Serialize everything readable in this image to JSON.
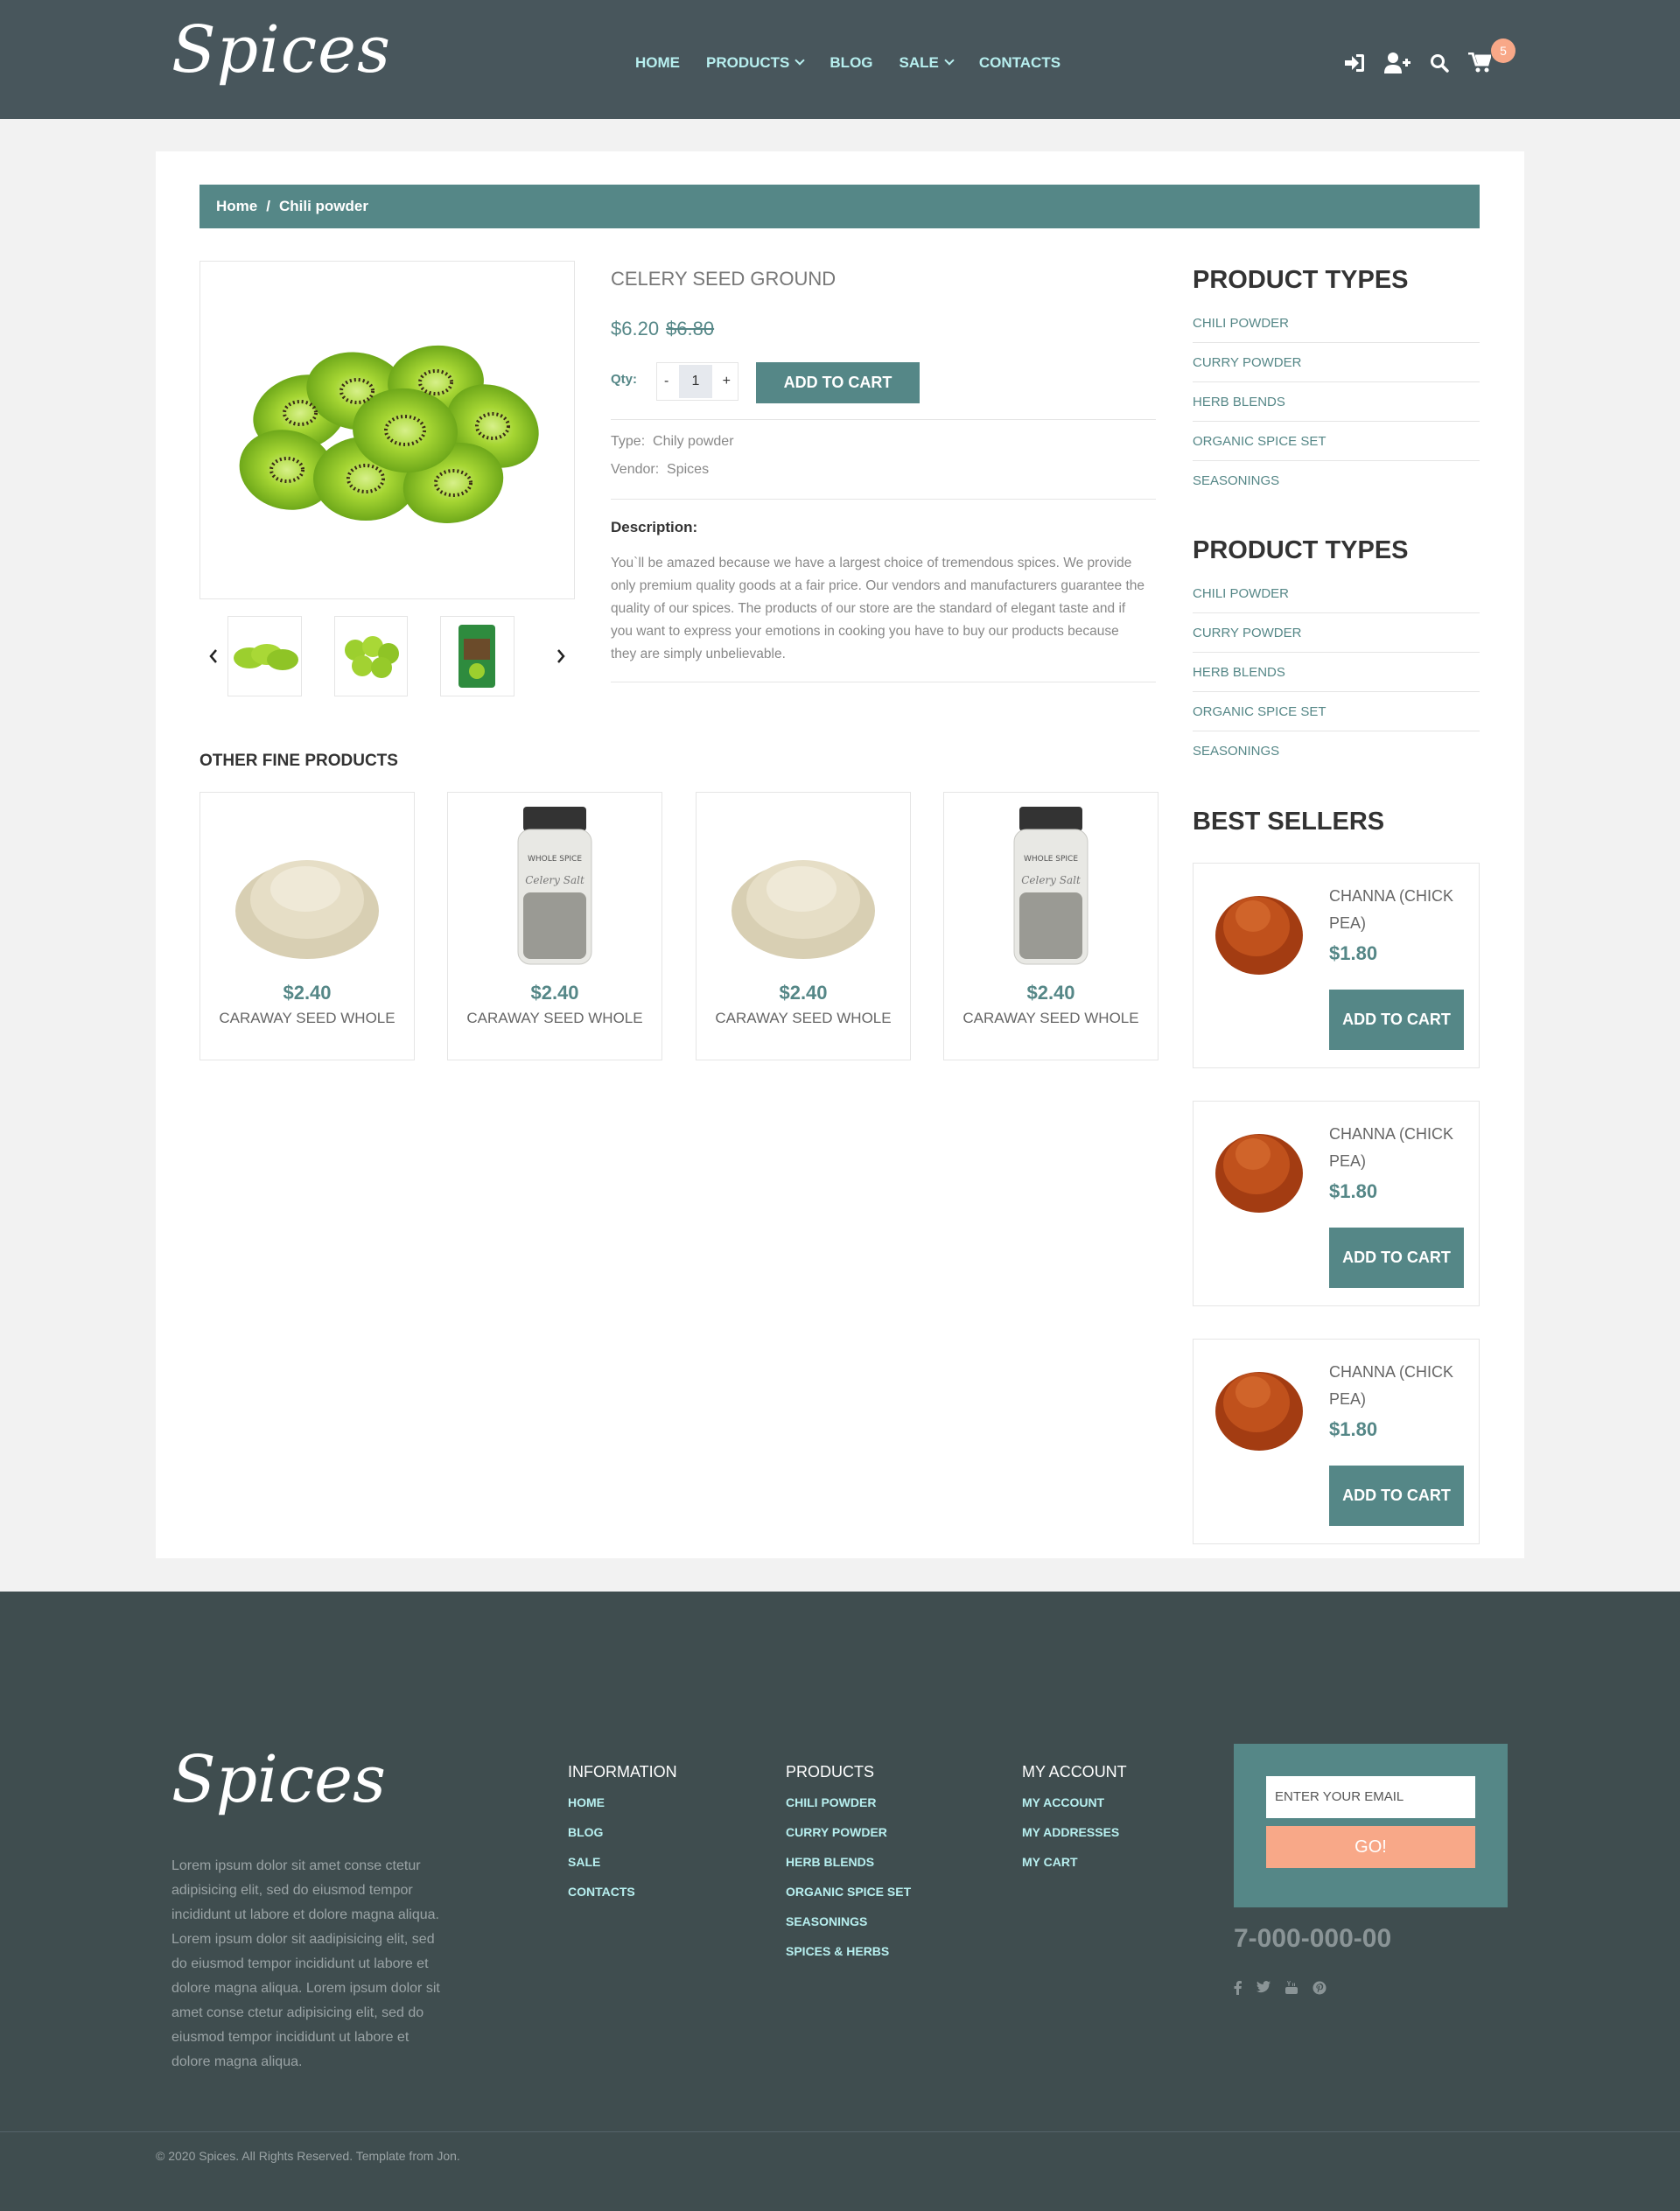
{
  "header": {
    "logo": "Spices",
    "nav": [
      {
        "label": "HOME"
      },
      {
        "label": "PRODUCTS"
      },
      {
        "label": "BLOG"
      },
      {
        "label": "SALE"
      },
      {
        "label": "CONTACTS"
      }
    ],
    "cart_count": "5"
  },
  "breadcrumb": {
    "home": "Home",
    "sep": "/",
    "current": "Chili powder"
  },
  "product": {
    "title": "CELERY SEED GROUND",
    "price": "$6.20",
    "old_price": "$6.80",
    "qty_label": "Qty:",
    "qty_minus": "-",
    "qty_value": "1",
    "qty_plus": "+",
    "add_to_cart": "ADD TO CART",
    "type_label": "Type:",
    "type_value": "Chily powder",
    "vendor_label": "Vendor:",
    "vendor_value": "Spices",
    "description_heading": "Description:",
    "description": "You`ll be amazed because we have a largest choice of tremendous spices. We provide only premium quality goods at a fair price. Our vendors and manufacturers guarantee the quality of our spices. The products of our store are the standard of elegant taste and if you want to express your emotions in cooking you have to buy our products because they are simply unbelievable."
  },
  "other_products": {
    "heading": "OTHER FINE PRODUCTS",
    "items": [
      {
        "price": "$2.40",
        "name": "CARAWAY SEED WHOLE"
      },
      {
        "price": "$2.40",
        "name": "CARAWAY SEED WHOLE"
      },
      {
        "price": "$2.40",
        "name": "CARAWAY SEED WHOLE"
      },
      {
        "price": "$2.40",
        "name": "CARAWAY SEED WHOLE"
      }
    ],
    "jar_label": "WHOLE SPICE",
    "jar_script": "Celery Salt"
  },
  "sidebar": {
    "types_heading_1": "PRODUCT TYPES",
    "types_1": [
      "CHILI POWDER",
      "CURRY POWDER",
      "HERB BLENDS",
      "ORGANIC SPICE SET",
      "SEASONINGS"
    ],
    "types_heading_2": "PRODUCT TYPES",
    "types_2": [
      "CHILI POWDER",
      "CURRY POWDER",
      "HERB BLENDS",
      "ORGANIC SPICE SET",
      "SEASONINGS"
    ],
    "best_heading": "BEST SELLERS",
    "best": [
      {
        "name": "CHANNA (CHICK PEA)",
        "price": "$1.80",
        "button": "ADD TO CART"
      },
      {
        "name": "CHANNA (CHICK PEA)",
        "price": "$1.80",
        "button": "ADD TO CART"
      },
      {
        "name": "CHANNA (CHICK PEA)",
        "price": "$1.80",
        "button": "ADD TO CART"
      }
    ]
  },
  "footer": {
    "logo": "Spices",
    "about": "Lorem ipsum dolor sit amet conse ctetur adipisicing elit, sed do eiusmod tempor incididunt ut labore et dolore magna aliqua. Lorem ipsum dolor sit aadipisicing elit, sed do eiusmod tempor incididunt ut labore et dolore magna aliqua. Lorem ipsum dolor sit amet conse ctetur adipisicing elit, sed do eiusmod tempor incididunt ut labore et dolore magna aliqua.",
    "information": {
      "heading": "INFORMATION",
      "links": [
        "HOME",
        "BLOG",
        "SALE",
        "CONTACTS"
      ]
    },
    "products": {
      "heading": "PRODUCTS",
      "links": [
        "CHILI POWDER",
        "CURRY POWDER",
        "HERB BLENDS",
        "ORGANIC SPICE SET",
        "SEASONINGS",
        "SPICES & HERBS"
      ]
    },
    "account": {
      "heading": "MY ACCOUNT",
      "links": [
        "MY ACCOUNT",
        "MY ADDRESSES",
        "MY CART"
      ]
    },
    "newsletter": {
      "placeholder": "ENTER YOUR EMAIL",
      "button": "GO!"
    },
    "phone": "7-000-000-00",
    "social": [
      "facebook-icon",
      "twitter-icon",
      "youtube-icon",
      "pinterest-icon"
    ],
    "copyright": "© 2020 Spices. All Rights Reserved. Template from Jon."
  },
  "colors": {
    "header_bg": "#48565c",
    "accent": "#558787",
    "nav_text": "#b7efef",
    "badge": "#f8a888",
    "footer_bg": "#3f4d4f"
  }
}
